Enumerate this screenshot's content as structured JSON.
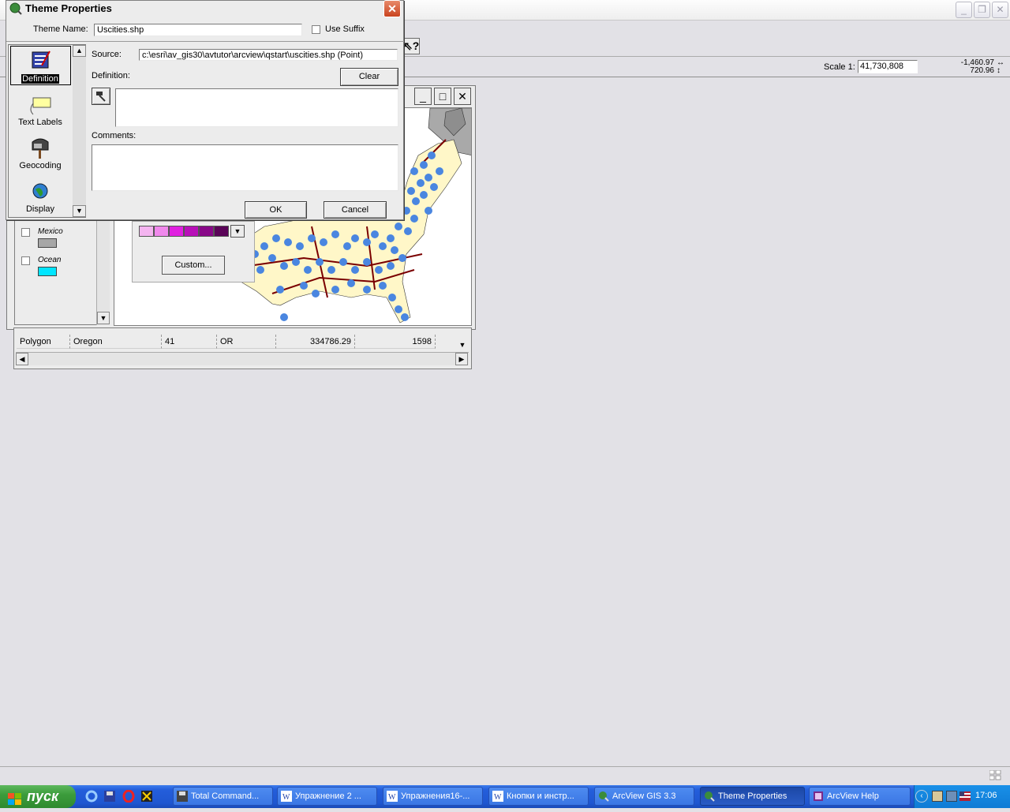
{
  "app": {
    "window_controls": [
      "_",
      "❐",
      "✕"
    ]
  },
  "status": {
    "scale_label": "Scale 1:",
    "scale_value": "41,730,808",
    "coord_x": "-1,460.97",
    "coord_y": "720.96"
  },
  "toc": {
    "layers": [
      {
        "label": "Mexico",
        "color": "#a7a7a7"
      },
      {
        "label": "Ocean",
        "color": "#00e5ff"
      }
    ]
  },
  "legend": {
    "ramp": [
      "#f4b4f0",
      "#f088ec",
      "#e020e0",
      "#b810b8",
      "#880888",
      "#5a0458"
    ],
    "custom_label": "Custom..."
  },
  "table": {
    "row": [
      "Polygon",
      "Oregon",
      "41",
      "OR",
      "334786.29",
      "1598"
    ]
  },
  "dialog": {
    "title": "Theme Properties",
    "theme_name_label": "Theme Name:",
    "theme_name_value": "Uscities.shp",
    "use_suffix_label": "Use Suffix",
    "source_label": "Source:",
    "source_value": "c:\\esri\\av_gis30\\avtutor\\arcview\\qstart\\uscities.shp (Point)",
    "definition_label": "Definition:",
    "clear_label": "Clear",
    "comments_label": "Comments:",
    "ok_label": "OK",
    "cancel_label": "Cancel",
    "categories": [
      {
        "label": "Definition",
        "icon": "definition-icon",
        "selected": true
      },
      {
        "label": "Text Labels",
        "icon": "text-labels-icon"
      },
      {
        "label": "Geocoding",
        "icon": "geocoding-icon"
      },
      {
        "label": "Display",
        "icon": "display-icon"
      }
    ]
  },
  "taskbar": {
    "start_label": "пуск",
    "tasks": [
      {
        "label": "Total Command...",
        "icon": "floppy-icon"
      },
      {
        "label": "Упражнение 2 ...",
        "icon": "word-icon"
      },
      {
        "label": "Упражнения16-...",
        "icon": "word-icon"
      },
      {
        "label": "Кнопки и инстр...",
        "icon": "word-icon"
      },
      {
        "label": "ArcView GIS 3.3",
        "icon": "arcview-icon"
      },
      {
        "label": "Theme Properties",
        "icon": "arcview-icon",
        "active": true
      },
      {
        "label": "ArcView Help",
        "icon": "help-book-icon"
      }
    ],
    "clock": "17:06"
  }
}
